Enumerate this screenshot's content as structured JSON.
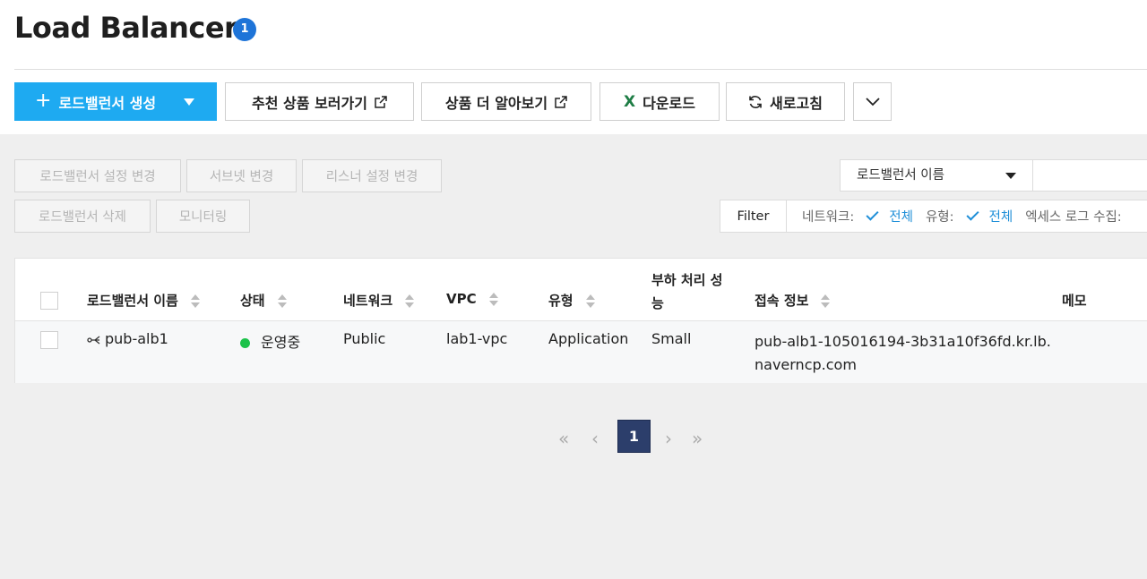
{
  "header": {
    "title": "Load Balancer",
    "count": "1"
  },
  "toolbar": {
    "create_label": "로드밸런서 생성",
    "recommend_label": "추천 상품 보러가기",
    "learn_more_label": "상품 더 알아보기",
    "download_label": "다운로드",
    "refresh_label": "새로고침"
  },
  "actions": {
    "edit_settings": "로드밸런서 설정 변경",
    "edit_subnet": "서브넷 변경",
    "edit_listener": "리스너 설정 변경",
    "delete": "로드밸런서 삭제",
    "monitoring": "모니터링"
  },
  "search": {
    "field": "로드밸런서 이름"
  },
  "filter": {
    "label": "Filter",
    "network_key": "네트워크:",
    "network_value": "전체",
    "type_key": "유형:",
    "type_value": "전체",
    "access_log_key": "엑세스 로그 수집:"
  },
  "table": {
    "columns": {
      "name": "로드밸런서 이름",
      "status": "상태",
      "network": "네트워크",
      "vpc": "VPC",
      "type": "유형",
      "performance_1": "부하 처리 성",
      "performance_2": "능",
      "endpoint": "접속 정보",
      "memo": "메모"
    },
    "rows": [
      {
        "name": "pub-alb1",
        "status": "운영중",
        "network": "Public",
        "vpc": "lab1-vpc",
        "type": "Application",
        "performance": "Small",
        "endpoint_1": "pub-alb1-105016194-3b31a10f36fd.kr.lb.",
        "endpoint_2": "naverncp.com",
        "memo": ""
      }
    ]
  },
  "pagination": {
    "current": "1"
  },
  "colors": {
    "primary": "#1eaaf1",
    "badge": "#1e74d8",
    "status_running": "#1cc24a",
    "page_active": "#2c3e6b",
    "filter_value": "#1f8fd8"
  }
}
